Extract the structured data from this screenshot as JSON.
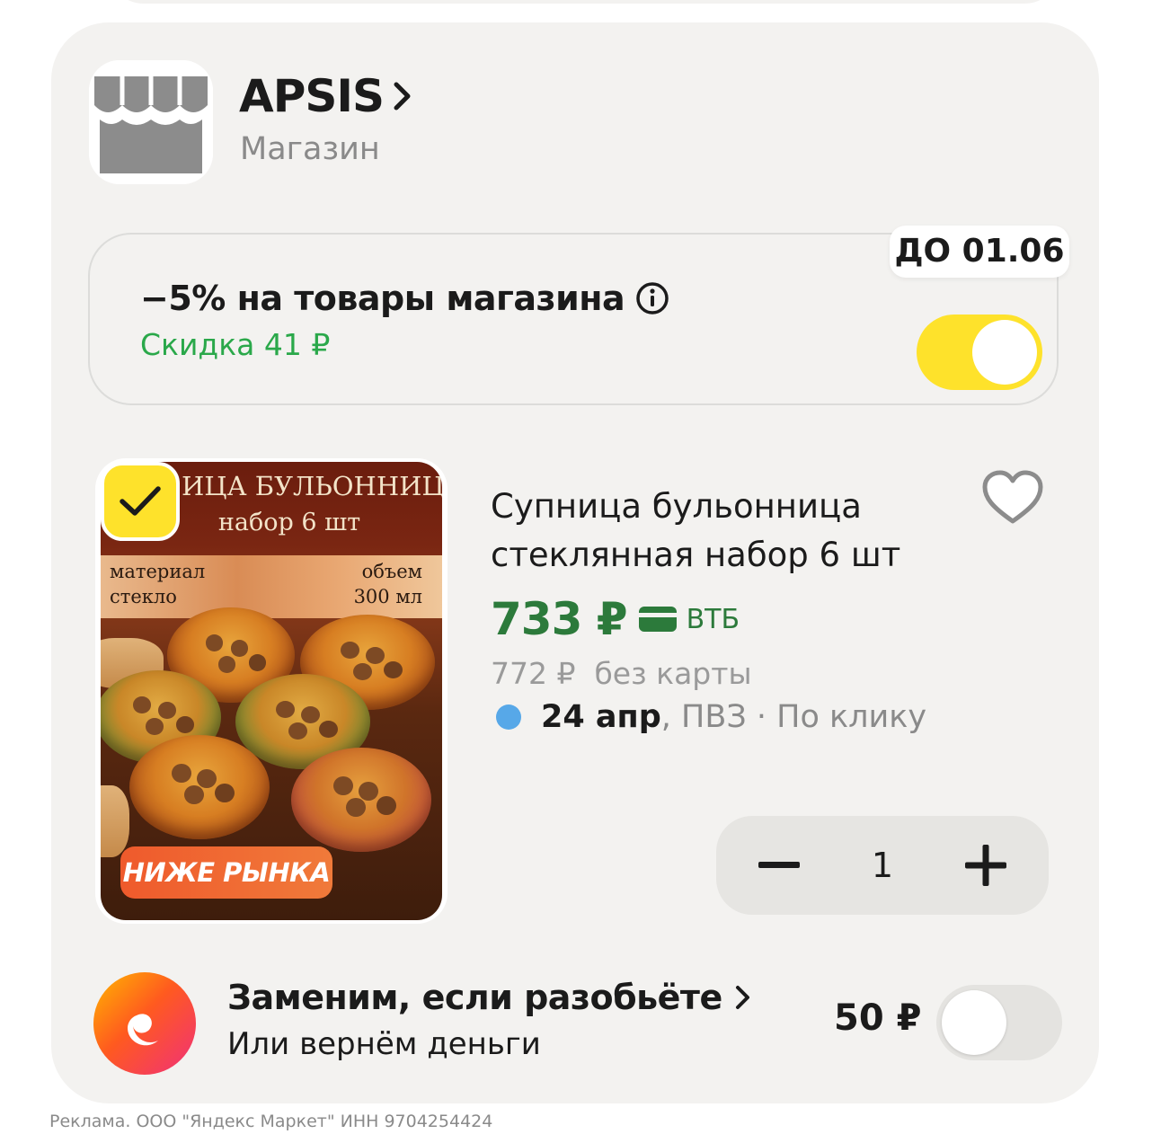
{
  "shop": {
    "name": "APSIS",
    "type": "Магазин",
    "logo_icon": "store-awning-icon"
  },
  "promo": {
    "title": "−5% на товары магазина",
    "discount": "Скидка 41 ₽",
    "until": "ДО 01.06",
    "toggle_on": true,
    "accent_color": "#fee22b",
    "discount_color": "#2aa84a"
  },
  "product": {
    "image_text": {
      "title_line1": "ИЦА БУЛЬОННИЦА",
      "title_line2": "набор 6 шт",
      "material_label": "материал",
      "material_value": "стекло",
      "volume_label": "объем",
      "volume_value": "300 мл",
      "badge": "НИЖЕ РЫНКА"
    },
    "selected": true,
    "title": "Супница бульонница стеклянная набор 6 шт",
    "price": "733 ₽",
    "bank": "ВТБ",
    "price_without_card": "772 ₽  без карты",
    "delivery_date": "24 апр",
    "delivery_rest": ", ПВЗ · По клику",
    "quantity": "1",
    "price_color": "#2c7a3b",
    "delivery_dot_color": "#57a8e8"
  },
  "insurance": {
    "title": "Заменим, если разобьёте",
    "subtitle": "Или вернём деньги",
    "price": "50 ₽",
    "toggle_on": false
  },
  "footer": {
    "ad_text": "Реклама. ООО \"Яндекс Маркет\" ИНН 9704254424"
  }
}
